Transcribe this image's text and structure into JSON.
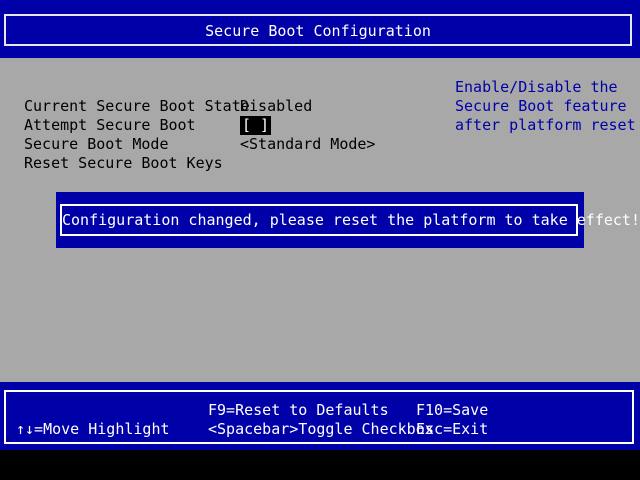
{
  "title": "Secure Boot Configuration",
  "settings": [
    {
      "label": "Current Secure Boot State",
      "value": "Disabled"
    },
    {
      "label": "Attempt Secure Boot",
      "value": "[ ]"
    },
    {
      "label": "Secure Boot Mode",
      "value": "<Standard Mode>"
    },
    {
      "label": "Reset Secure Boot Keys",
      "value": ""
    }
  ],
  "help": {
    "lines": [
      "Enable/Disable the",
      "Secure Boot feature",
      "after platform reset"
    ]
  },
  "dialog": {
    "message": "Configuration changed, please reset the platform to take effect!"
  },
  "footer": {
    "move_highlight": "↑↓=Move Highlight",
    "reset_defaults": "F9=Reset to Defaults",
    "toggle_checkbox": "<Spacebar>Toggle Checkbox",
    "save": "F10=Save",
    "exit": "Esc=Exit"
  },
  "colors": {
    "title_bg": "#0000a8",
    "main_bg": "#a8a8a8",
    "help_text": "#0000a8",
    "dialog_bg": "#0000a8",
    "footer_bg": "#0000a8"
  }
}
